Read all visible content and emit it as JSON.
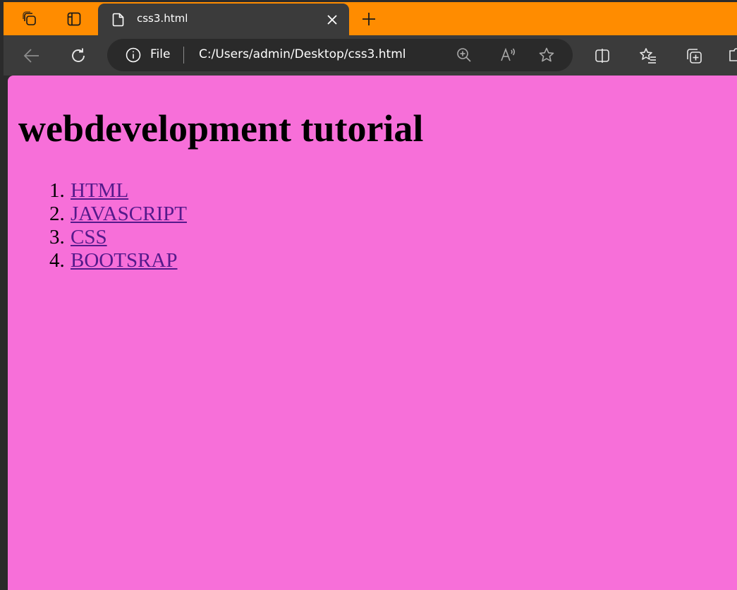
{
  "browser": {
    "tab": {
      "title": "css3.html"
    },
    "address_bar": {
      "scheme_label": "File",
      "url": "C:/Users/admin/Desktop/css3.html"
    },
    "icons": {
      "workspaces": "workspaces-icon",
      "tab_actions": "tab-actions-icon",
      "tab_favicon": "page-file-icon",
      "tab_close": "close-icon",
      "new_tab": "plus-icon",
      "back": "back-arrow-icon",
      "refresh": "refresh-icon",
      "site_info": "info-icon",
      "zoom": "zoom-in-icon",
      "read_aloud": "read-aloud-icon",
      "favorite": "star-icon",
      "split_screen": "split-screen-icon",
      "favorites": "favorites-icon",
      "collections": "collections-icon"
    },
    "colors": {
      "tabstrip": "#ff8c00",
      "toolbar": "#3b3b3b",
      "page_background": "#f76fd9",
      "link": "#551a8b"
    }
  },
  "page": {
    "heading": "webdevelopment tutorial",
    "links": [
      {
        "label": "HTML"
      },
      {
        "label": "JAVASCRIPT"
      },
      {
        "label": "CSS"
      },
      {
        "label": "BOOTSRAP"
      }
    ]
  }
}
